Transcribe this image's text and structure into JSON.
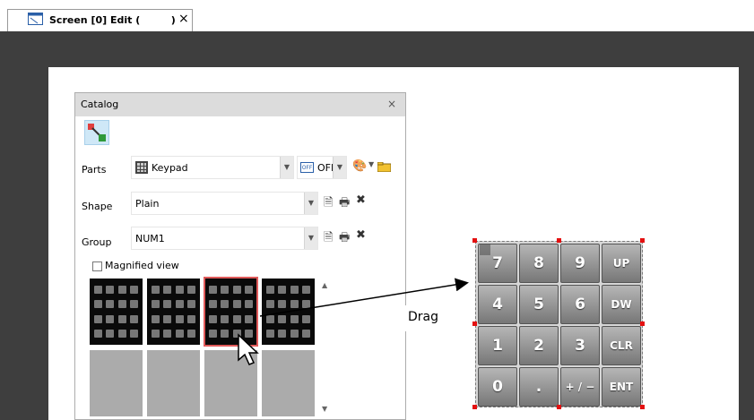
{
  "tab": {
    "title": "Screen [0] Edit (         )",
    "close": "×"
  },
  "catalog": {
    "title": "Catalog",
    "close": "×",
    "parts": {
      "label": "Parts",
      "value": "Keypad",
      "off_value": "OFF"
    },
    "shape": {
      "label": "Shape",
      "value": "Plain"
    },
    "group": {
      "label": "Group",
      "value": "NUM1"
    },
    "magnified_view": "Magnified view"
  },
  "keypad": {
    "keys": [
      {
        "label": "7"
      },
      {
        "label": "8"
      },
      {
        "label": "9"
      },
      {
        "label": "UP"
      },
      {
        "label": "4"
      },
      {
        "label": "5"
      },
      {
        "label": "6"
      },
      {
        "label": "DW"
      },
      {
        "label": "1"
      },
      {
        "label": "2"
      },
      {
        "label": "3"
      },
      {
        "label": "CLR"
      },
      {
        "label": "0"
      },
      {
        "label": "."
      },
      {
        "label": "+ / −"
      },
      {
        "label": "ENT"
      }
    ]
  },
  "annotation": {
    "drag": "Drag"
  },
  "colors": {
    "editor_bg": "#3e3e3e",
    "selection": "#e05a5a",
    "handle": "#e41010"
  }
}
